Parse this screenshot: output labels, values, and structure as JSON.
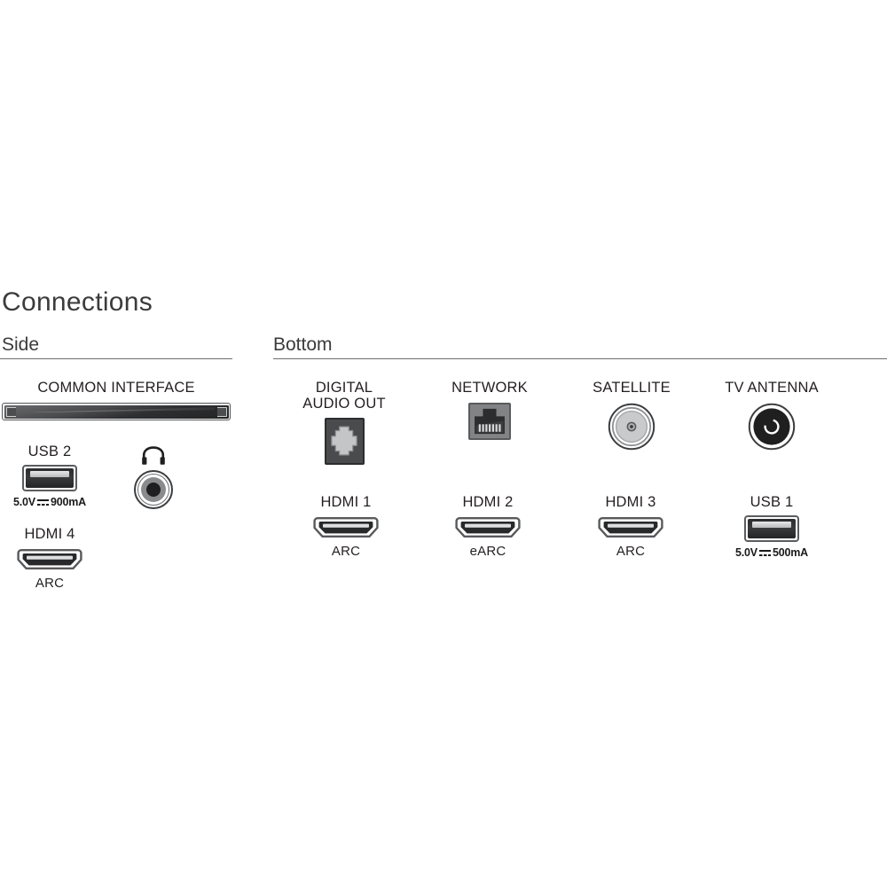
{
  "page": {
    "title": "Connections"
  },
  "sections": {
    "side": {
      "heading": "Side",
      "ports": {
        "common_interface": {
          "label": "COMMON INTERFACE",
          "icon": "common-interface-slot-icon"
        },
        "usb2": {
          "label": "USB 2",
          "power": "5.0V",
          "power_suffix": "900mA",
          "icon": "usb-port-icon"
        },
        "headphone": {
          "label": "",
          "icon": "headphone-jack-icon"
        },
        "hdmi4": {
          "label": "HDMI 4",
          "sublabel": "ARC",
          "icon": "hdmi-port-icon"
        }
      }
    },
    "bottom": {
      "heading": "Bottom",
      "ports": {
        "digital_audio_out": {
          "label": "DIGITAL\nAUDIO OUT",
          "icon": "optical-audio-port-icon"
        },
        "network": {
          "label": "NETWORK",
          "icon": "rj45-network-port-icon"
        },
        "satellite": {
          "label": "SATELLITE",
          "icon": "satellite-f-connector-icon"
        },
        "tv_antenna": {
          "label": "TV ANTENNA",
          "icon": "tv-antenna-coax-icon"
        },
        "hdmi1": {
          "label": "HDMI 1",
          "sublabel": "ARC",
          "icon": "hdmi-port-icon"
        },
        "hdmi2": {
          "label": "HDMI 2",
          "sublabel": "eARC",
          "icon": "hdmi-port-icon"
        },
        "hdmi3": {
          "label": "HDMI 3",
          "sublabel": "ARC",
          "icon": "hdmi-port-icon"
        },
        "usb1": {
          "label": "USB 1",
          "power": "5.0V",
          "power_suffix": "500mA",
          "icon": "usb-port-icon"
        }
      }
    }
  },
  "colors": {
    "text": "#231f20",
    "heading": "#3b3b3b",
    "divider": "#6d6e71",
    "port_dark": "#2e2f31",
    "port_mid": "#828385",
    "port_light": "#c9cacb",
    "background": "#ffffff"
  }
}
